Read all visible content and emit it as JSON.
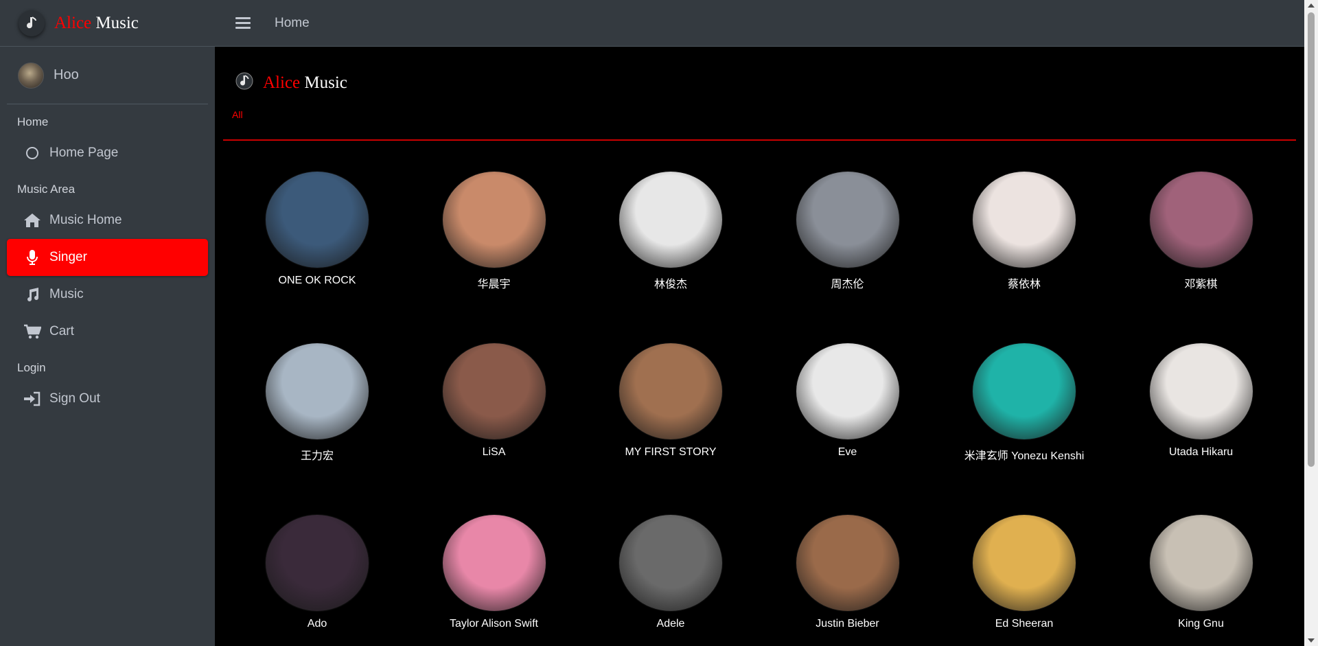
{
  "brand": {
    "alice": "Alice",
    "music": "Music"
  },
  "user": {
    "name": "Hoo"
  },
  "nav": {
    "sections": [
      {
        "header": "Home",
        "items": [
          {
            "label": "Home Page",
            "icon": "circle-icon"
          }
        ]
      },
      {
        "header": "Music Area",
        "items": [
          {
            "label": "Music Home",
            "icon": "house-icon"
          },
          {
            "label": "Singer",
            "icon": "microphone-icon",
            "active": true
          },
          {
            "label": "Music",
            "icon": "music-note-icon"
          },
          {
            "label": "Cart",
            "icon": "cart-icon"
          }
        ]
      },
      {
        "header": "Login",
        "items": [
          {
            "label": "Sign Out",
            "icon": "sign-in-icon"
          }
        ]
      }
    ]
  },
  "topbar": {
    "title": "Home"
  },
  "filter": {
    "all_label": "All"
  },
  "colors": {
    "accent": "#ff0000",
    "sidebar": "#343a40",
    "background": "#000000"
  },
  "singers": [
    {
      "name": "ONE OK ROCK",
      "photo": "#3c5a7a"
    },
    {
      "name": "华晨宇",
      "photo": "#c98a6a"
    },
    {
      "name": "林俊杰",
      "photo": "#e7e7e7"
    },
    {
      "name": "周杰伦",
      "photo": "#8a8f98"
    },
    {
      "name": "蔡依林",
      "photo": "#ece3e0"
    },
    {
      "name": "邓紫棋",
      "photo": "#a0627a"
    },
    {
      "name": "王力宏",
      "photo": "#a8b6c4"
    },
    {
      "name": "LiSA",
      "photo": "#8a5a4a"
    },
    {
      "name": "MY FIRST STORY",
      "photo": "#a07050"
    },
    {
      "name": "Eve",
      "photo": "#e8e8e8"
    },
    {
      "name": "米津玄师 Yonezu Kenshi",
      "photo": "#1fb3a8"
    },
    {
      "name": "Utada Hikaru",
      "photo": "#e9e5e2"
    },
    {
      "name": "Ado",
      "photo": "#3a2a3a"
    },
    {
      "name": "Taylor Alison Swift",
      "photo": "#e887a8"
    },
    {
      "name": "Adele",
      "photo": "#6a6a6a"
    },
    {
      "name": "Justin Bieber",
      "photo": "#9a6a4a"
    },
    {
      "name": "Ed Sheeran",
      "photo": "#e0b050"
    },
    {
      "name": "King Gnu",
      "photo": "#c8c0b4"
    }
  ]
}
